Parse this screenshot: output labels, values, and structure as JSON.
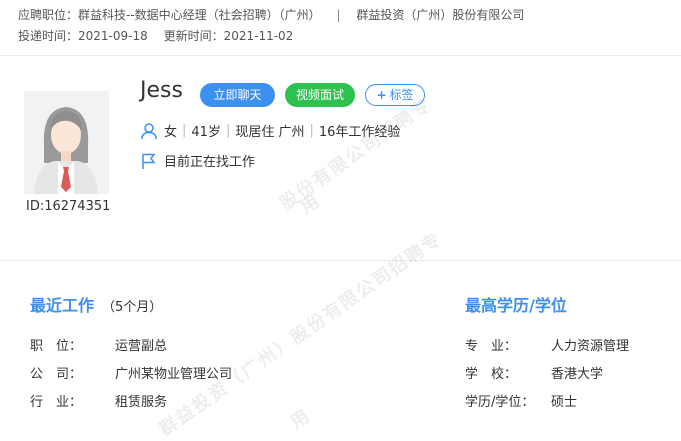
{
  "header": {
    "position_line": "应聘职位：群益科技--数据中心经理（社会招聘）（广州）",
    "separator": "|",
    "company": "群益投资（广州）股份有限公司",
    "submit_time": "投递时间：2021-09-18",
    "update_time": "更新时间：2021-11-02"
  },
  "candidate": {
    "name": "Jess",
    "id_text": "ID:16274351",
    "gender": "女",
    "age": "41岁",
    "residence": "现居住 广州",
    "experience": "16年工作经验",
    "status": "目前正在找工作"
  },
  "actions": {
    "chat": "立即聊天",
    "video": "视频面试",
    "tag": "标签"
  },
  "recent_work": {
    "title": "最近工作",
    "duration": "（5个月）",
    "rows": [
      {
        "label": "职　位：",
        "value": "运营副总"
      },
      {
        "label": "公　司：",
        "value": "广州某物业管理公司"
      },
      {
        "label": "行　业：",
        "value": "租赁服务"
      }
    ]
  },
  "education": {
    "title": "最高学历/学位",
    "rows": [
      {
        "label": "专　业：",
        "value": "人力资源管理"
      },
      {
        "label": "学　校：",
        "value": "香港大学"
      },
      {
        "label": "学历/学位：",
        "value": "硕士"
      }
    ]
  },
  "watermarks": [
    "股份有限公司招聘专",
    "用",
    "群益投资（广州）股份有限公司招聘专",
    "用"
  ],
  "colors": {
    "accent": "#3d8ff0",
    "green": "#2dc24f"
  }
}
